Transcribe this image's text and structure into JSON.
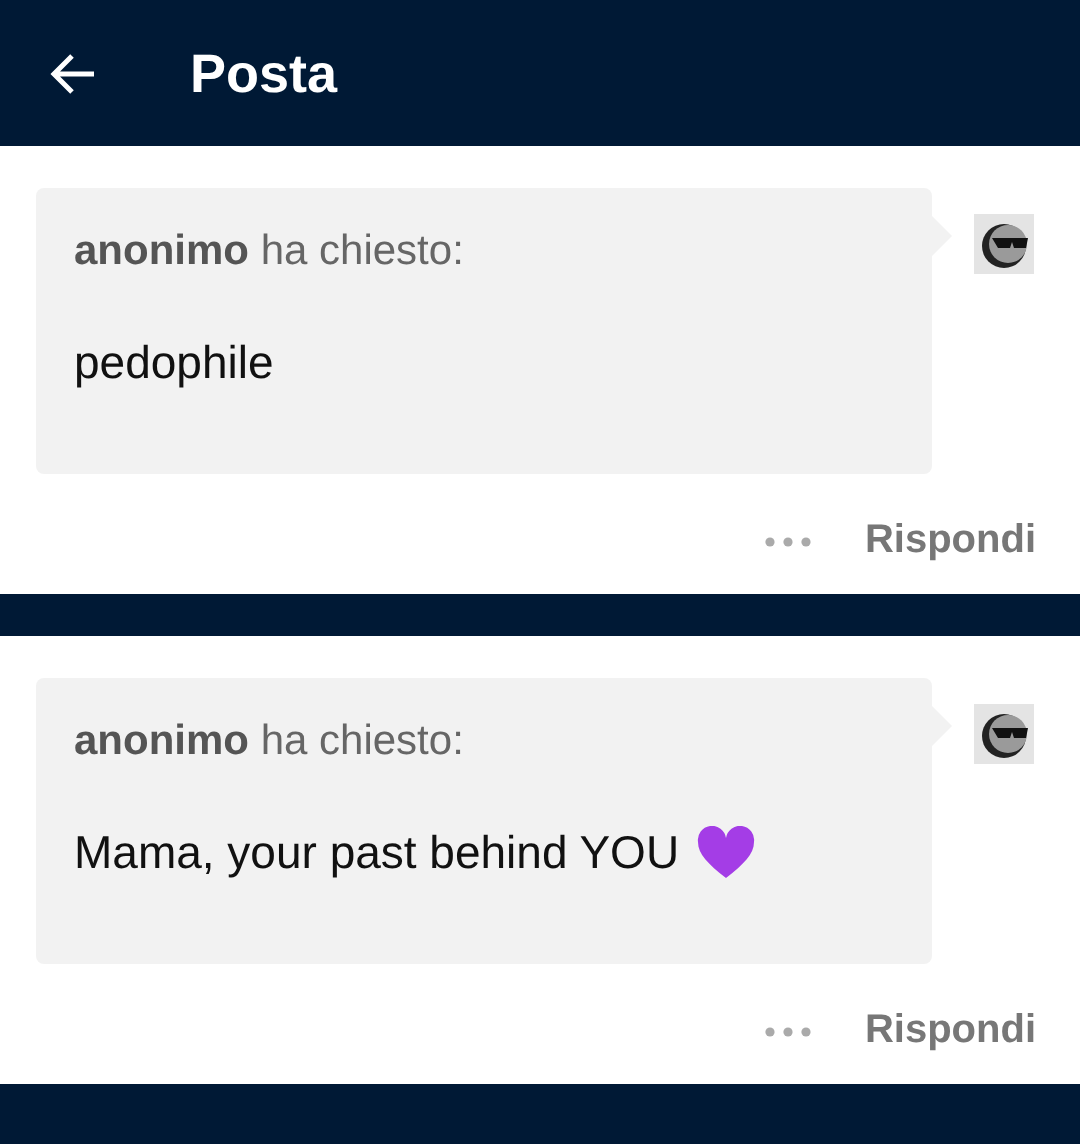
{
  "header": {
    "title": "Posta"
  },
  "asks": [
    {
      "sender": "anonimo",
      "verb": "ha chiesto:",
      "question": "pedophile",
      "heart": false,
      "reply_label": "Rispondi"
    },
    {
      "sender": "anonimo",
      "verb": "ha chiesto:",
      "question": "Mama, your past behind YOU",
      "heart": true,
      "reply_label": "Rispondi"
    }
  ]
}
